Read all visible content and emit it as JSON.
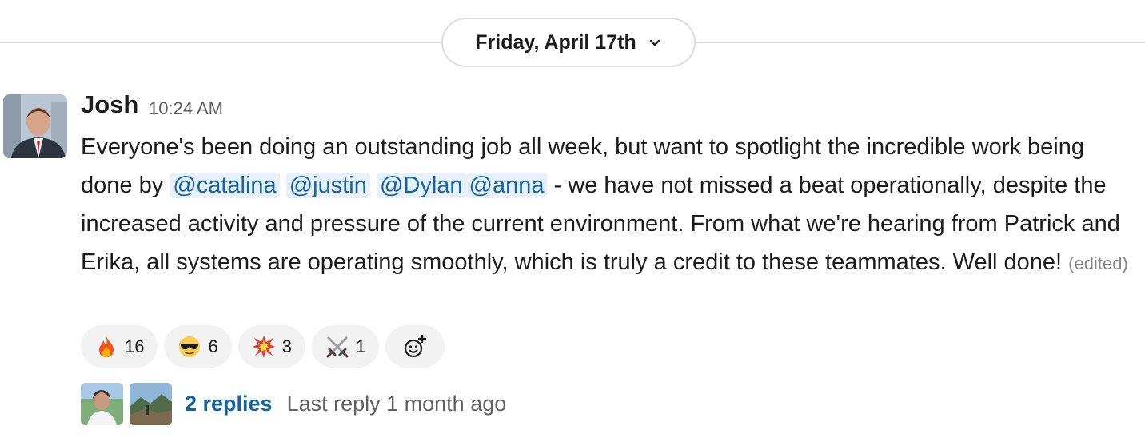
{
  "divider": {
    "date_label": "Friday, April 17th"
  },
  "message": {
    "author": "Josh",
    "time": "10:24 AM",
    "text_part1": "Everyone's been doing an outstanding job all week, but want to spotlight the incredible work being done by ",
    "mentions": [
      "@catalina",
      "@justin",
      "@Dylan",
      "@anna"
    ],
    "text_part2": " - we have not missed a beat operationally, despite the increased activity and pressure of the current environment. From what we're hearing from Patrick and Erika, all systems are operating smoothly, which is truly a credit to these teammates. Well done! ",
    "edited_label": "(edited)"
  },
  "reactions": [
    {
      "icon": "fire-icon",
      "count": "16"
    },
    {
      "icon": "sunglasses-face-icon",
      "count": "6"
    },
    {
      "icon": "collision-icon",
      "count": "3"
    },
    {
      "icon": "crossed-swords-icon",
      "count": "1"
    }
  ],
  "thread": {
    "replies_label": "2 replies",
    "last_reply_label": "Last reply 1 month ago"
  }
}
